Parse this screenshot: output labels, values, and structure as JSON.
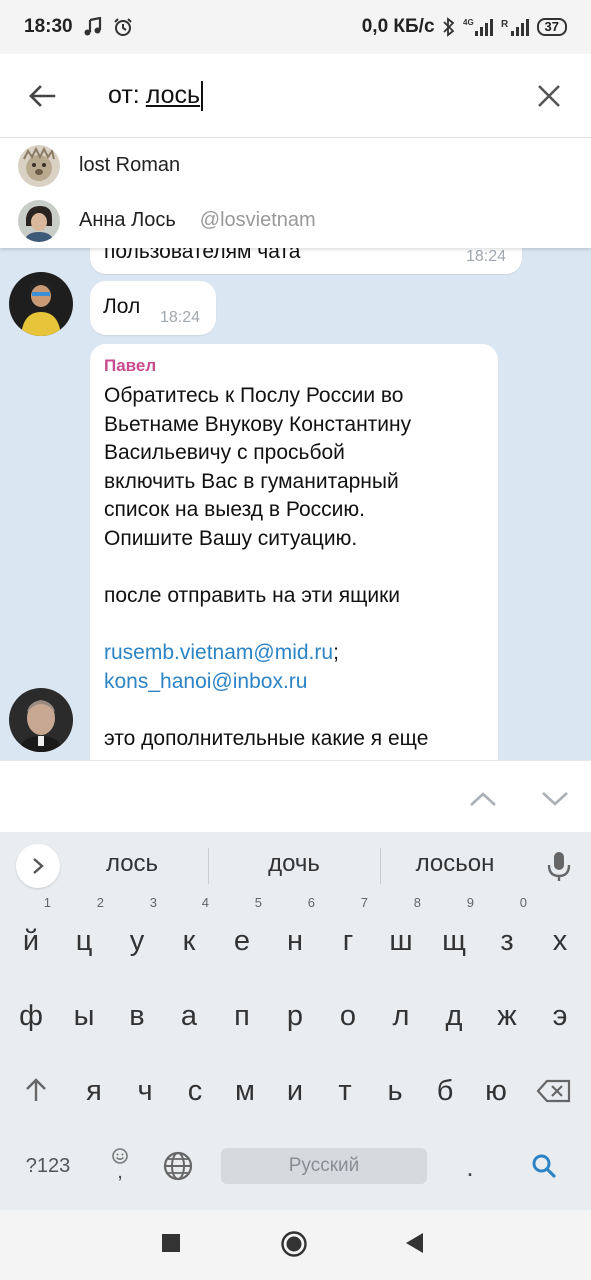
{
  "status_bar": {
    "time": "18:30",
    "net_speed": "0,0 КБ/с",
    "battery": "37",
    "icons": [
      "music-note-icon",
      "alarm-icon",
      "bluetooth-icon",
      "signal-4g-icon",
      "signal-r-icon",
      "battery-icon"
    ]
  },
  "search": {
    "prefix": "от:",
    "query": "лось"
  },
  "suggestions": [
    {
      "name": "lost Roman",
      "username": ""
    },
    {
      "name": "Анна Лось",
      "username": "@losvietnam"
    }
  ],
  "messages": {
    "top_partial": {
      "text": "пользователям чата",
      "time": "18:24"
    },
    "lol": {
      "text": "Лол",
      "time": "18:24"
    },
    "long": {
      "sender": "Павел",
      "lines": [
        "Обратитесь к Послу России во",
        "Вьетнаме Внукову Константину",
        "Васильевичу с просьбой",
        "включить Вас в гуманитарный",
        "список на выезд в Россию.",
        "Опишите Вашу ситуацию.",
        "после отправить на эти ящики",
        "rusemb.vietnam@mid.ru",
        ";",
        "kons_hanoi@inbox.ru",
        "это дополнительные какие я еще"
      ]
    }
  },
  "keyboard": {
    "suggestions": [
      "лось",
      "дочь",
      "лосьон"
    ],
    "row1": [
      "й",
      "ц",
      "у",
      "к",
      "е",
      "н",
      "г",
      "ш",
      "щ",
      "з",
      "х"
    ],
    "row1_hints": [
      "1",
      "2",
      "3",
      "4",
      "5",
      "6",
      "7",
      "8",
      "9",
      "0"
    ],
    "row2": [
      "ф",
      "ы",
      "в",
      "а",
      "п",
      "р",
      "о",
      "л",
      "д",
      "ж",
      "э"
    ],
    "row3": [
      "я",
      "ч",
      "с",
      "м",
      "и",
      "т",
      "ь",
      "б",
      "ю"
    ],
    "numbers_key": "?123",
    "emoji_hint": ",",
    "space_label": "Русский",
    "period": ".",
    "accent_color": "#2d84c5"
  }
}
